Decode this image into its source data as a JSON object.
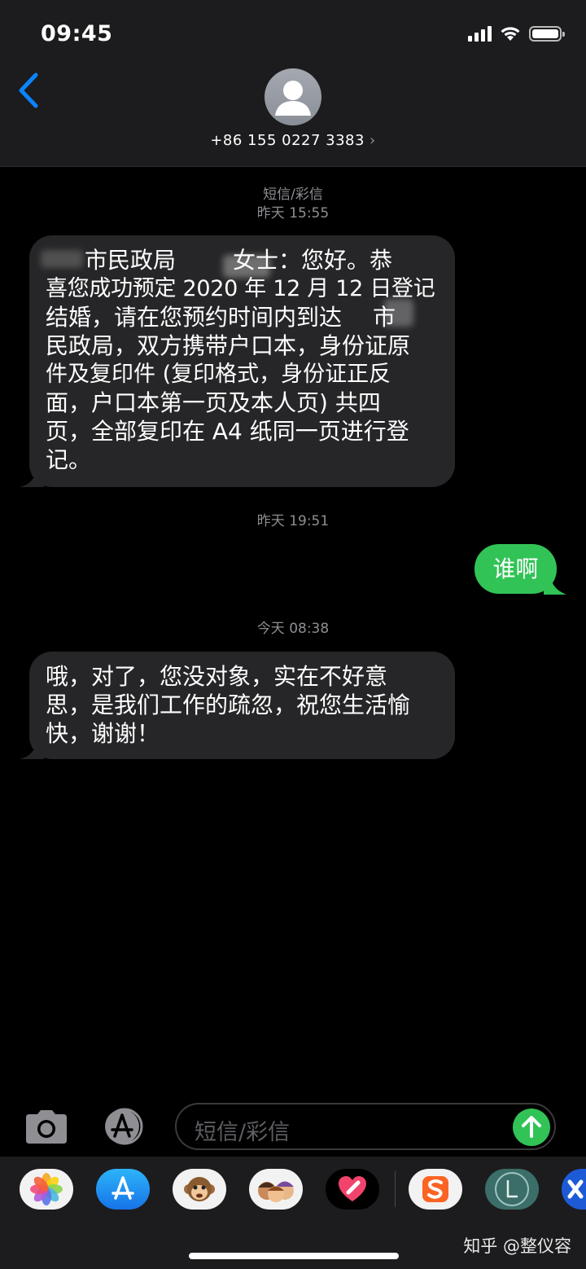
{
  "status_bar": {
    "time": "09:45"
  },
  "header": {
    "contact": "+86 155 0227 3383",
    "chevron": "›"
  },
  "conversation": [
    {
      "kind": "timestamp",
      "lines": [
        "短信/彩信",
        "昨天 15:55"
      ]
    },
    {
      "kind": "incoming",
      "lines": [
        "市民政局",
        "女士：您好。恭",
        "喜您成功预定 2020 年 12 月 12 日登记",
        "结婚，请在您预约时间内到达",
        "市",
        "民政局，双方携带户口本，身份证原",
        "件及复印件 (复印格式，身份证正反",
        "面，户口本第一页及本人页) 共四",
        "页，全部复印在 A4 纸同一页进行登",
        "记。"
      ]
    },
    {
      "kind": "timestamp",
      "lines": [
        "昨天 19:51"
      ]
    },
    {
      "kind": "outgoing",
      "text": "谁啊"
    },
    {
      "kind": "timestamp",
      "lines": [
        "今天 08:38"
      ]
    },
    {
      "kind": "incoming",
      "lines": [
        "哦，对了，您没对象，实在不好意",
        "思，是我们工作的疏忽，祝您生活愉",
        "快，谢谢！"
      ]
    }
  ],
  "compose": {
    "placeholder": "短信/彩信"
  },
  "app_drawer": {
    "icons": [
      "photos-icon",
      "app-store-icon",
      "animoji-monkey-icon",
      "memoji-icon",
      "digital-touch-heart-icon",
      "sogou-keyboard-icon",
      "circle-l-app-icon",
      "x-app-icon"
    ]
  },
  "watermark": "知乎 @整仪容",
  "colors": {
    "incoming_bubble": "#262628",
    "outgoing_bubble": "#31c356",
    "accent_blue": "#0a84ff",
    "timestamp_gray": "#8e8e93"
  }
}
